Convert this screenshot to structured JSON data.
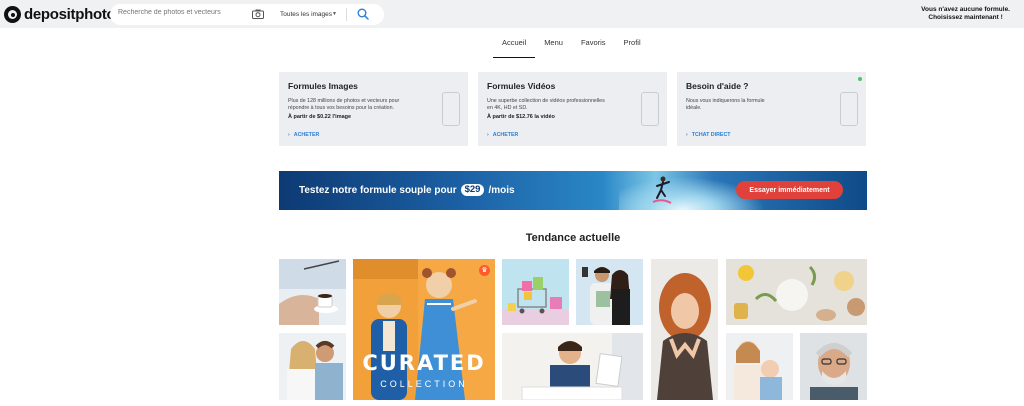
{
  "header": {
    "logo_text": "depositphotos",
    "logo_reg": "®",
    "search_placeholder": "Recherche de photos et vecteurs",
    "search_type": "Toutes les images",
    "account_line1": "Vous n'avez aucune formule.",
    "account_line2": "Choisissez maintenant !"
  },
  "tabs": [
    {
      "label": "Accueil",
      "active": true
    },
    {
      "label": "Menu",
      "active": false
    },
    {
      "label": "Favoris",
      "active": false
    },
    {
      "label": "Profil",
      "active": false
    }
  ],
  "cards": [
    {
      "title": "Formules Images",
      "description": "Plus de 128 millions de photos et vecteurs pour répondre à tous vos besoins pour la création.",
      "price": "À partir de $0.22 l'image",
      "link": "ACHETER"
    },
    {
      "title": "Formules Vidéos",
      "description": "Une superbe collection de vidéos professionnelles en 4K, HD et SD.",
      "price": "À partir de $12.76 la vidéo",
      "link": "ACHETER"
    },
    {
      "title": "Besoin d'aide ?",
      "description": "Nous vous indiquerons la formule idéale.",
      "price": "",
      "link": "TCHAT DIRECT"
    }
  ],
  "banner": {
    "text_before": "Testez notre formule souple pour",
    "price": "$29",
    "text_after": "/mois",
    "button": "Essayer immédiatement"
  },
  "trending": {
    "title": "Tendance actuelle",
    "curated_title": "CURATED",
    "curated_subtitle": "COLLECTION"
  },
  "colors": {
    "accent_blue": "#2d7fd4",
    "cta_red": "#e0413a",
    "online_green": "#4bc46a"
  }
}
